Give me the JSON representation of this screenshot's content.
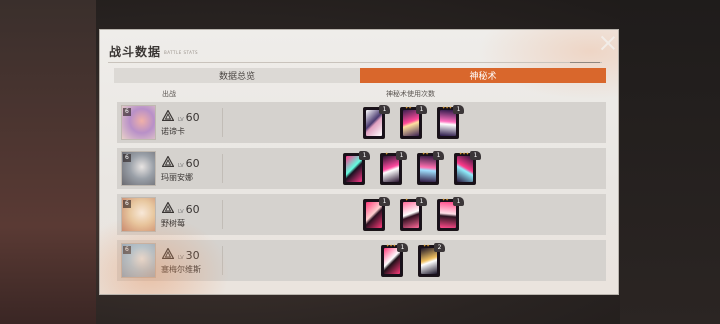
{
  "dialog": {
    "title": "战斗数据",
    "subtitle": "BATTLE STATS"
  },
  "tabs": [
    {
      "label": "数据总览",
      "active": false
    },
    {
      "label": "神秘术",
      "active": true
    }
  ],
  "columns": {
    "appearance": "出战",
    "usage": "神秘术使用次数"
  },
  "accent_color": "#d9672c",
  "rows": [
    {
      "level_tag": "LV",
      "level": "60",
      "name": "诺谛卡",
      "rank": "6",
      "portrait_colors": [
        "#b890c8",
        "#f0b0a8",
        "#e8d0c8"
      ],
      "cards": [
        {
          "badge": "1",
          "stars": "",
          "colors": [
            "#ffffff",
            "#4a3a70",
            "#e0a0c0"
          ]
        },
        {
          "badge": "1",
          "stars": "✦✦",
          "colors": [
            "#3a2050",
            "#ff4a9a",
            "#ffe0a0"
          ]
        },
        {
          "badge": "1",
          "stars": "✦✦✦",
          "colors": [
            "#2a1848",
            "#ff70c0",
            "#ffffff"
          ]
        }
      ]
    },
    {
      "level_tag": "LV",
      "level": "60",
      "name": "玛丽安娜",
      "rank": "6",
      "portrait_colors": [
        "#9aa0a8",
        "#e8e4e2",
        "#6a6a70"
      ],
      "cards": [
        {
          "badge": "1",
          "stars": "",
          "colors": [
            "#ff3a8a",
            "#60ffe0",
            "#1a1020"
          ]
        },
        {
          "badge": "1",
          "stars": "✦",
          "colors": [
            "#2a1430",
            "#ff4aa0",
            "#ffffff"
          ]
        },
        {
          "badge": "1",
          "stars": "✦✦",
          "colors": [
            "#301840",
            "#ff70b0",
            "#a0e0ff"
          ]
        },
        {
          "badge": "1",
          "stars": "✦✦✦",
          "colors": [
            "#28143a",
            "#ff3a8a",
            "#90f0ff"
          ]
        }
      ]
    },
    {
      "level_tag": "LV",
      "level": "60",
      "name": "野树莓",
      "rank": "6",
      "portrait_colors": [
        "#e8c8a0",
        "#f8e8d8",
        "#c88a70"
      ],
      "cards": [
        {
          "badge": "1",
          "stars": "",
          "colors": [
            "#ff3a7a",
            "#ffd0d0",
            "#2a1020"
          ]
        },
        {
          "badge": "1",
          "stars": "✦",
          "colors": [
            "#ff6a9a",
            "#ffffff",
            "#301020"
          ]
        },
        {
          "badge": "1",
          "stars": "✦✦",
          "colors": [
            "#ff4a8a",
            "#ffe0e8",
            "#2a1420"
          ]
        }
      ]
    },
    {
      "level_tag": "LV",
      "level": "30",
      "name": "塞梅尔维斯",
      "rank": "6",
      "portrait_colors": [
        "#a8d0e8",
        "#e8f4f8",
        "#8aa8c0"
      ],
      "cards": [
        {
          "badge": "1",
          "stars": "✦✦✦",
          "colors": [
            "#ff3a7a",
            "#ffffff",
            "#201018"
          ]
        },
        {
          "badge": "2",
          "stars": "✦✦",
          "colors": [
            "#1a1428",
            "#f0c060",
            "#ffffff"
          ]
        }
      ]
    }
  ]
}
